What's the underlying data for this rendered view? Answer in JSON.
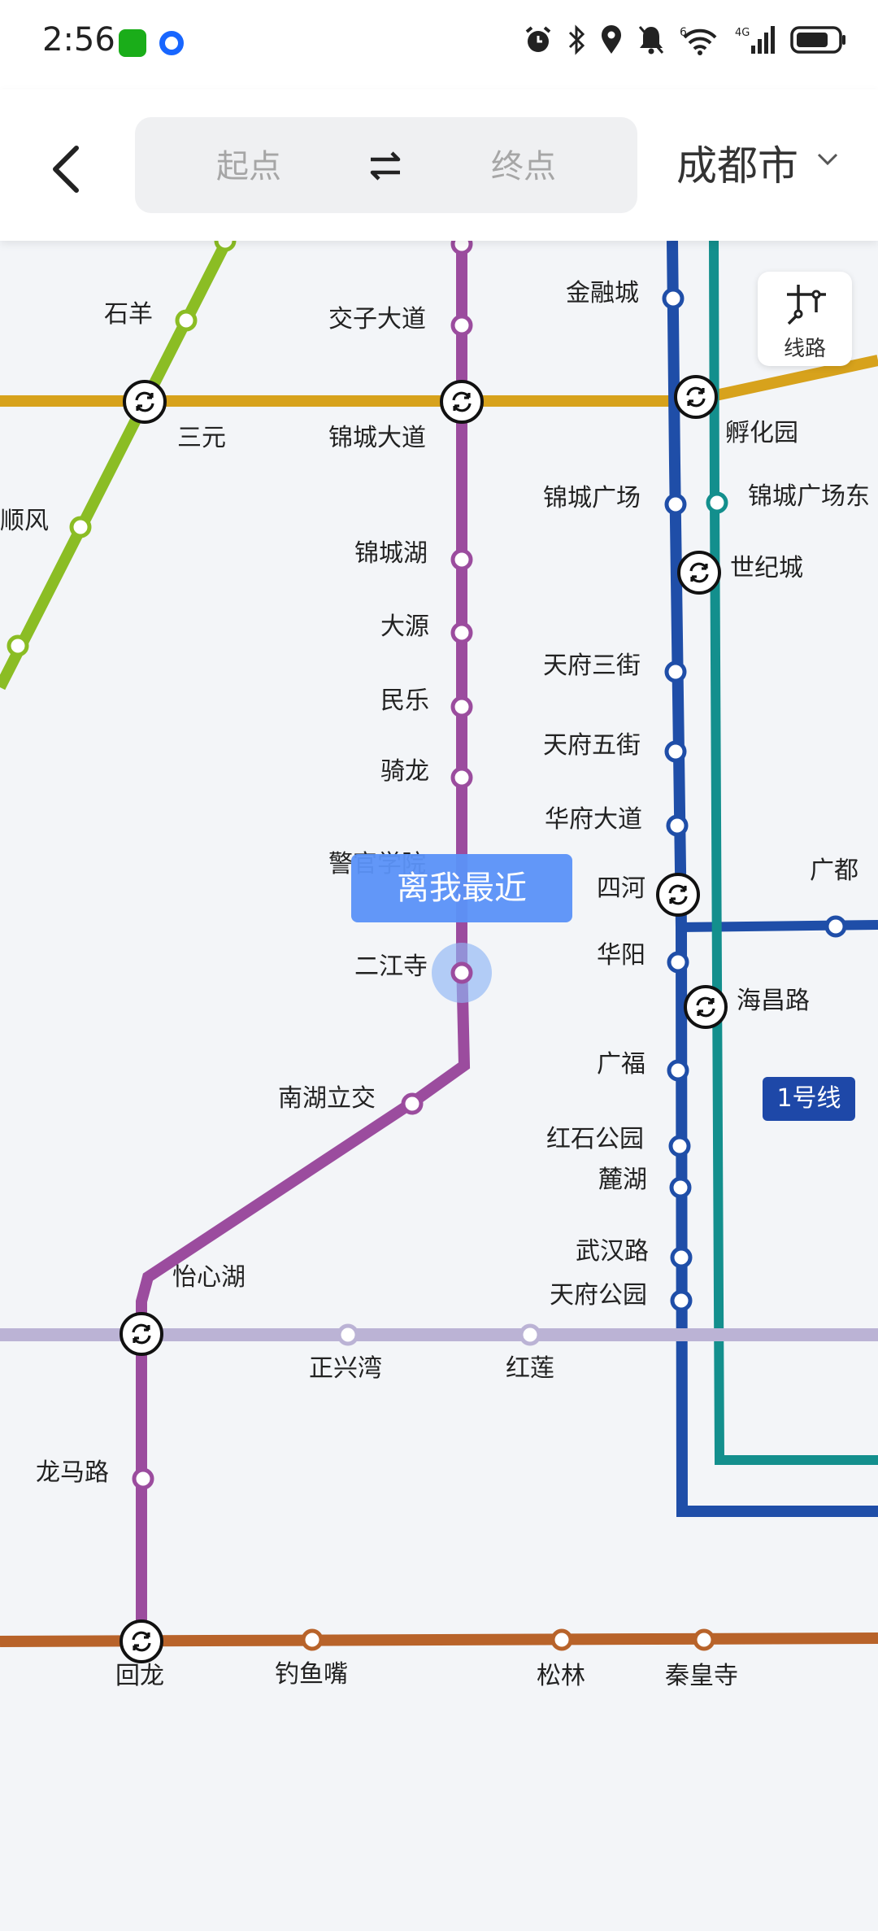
{
  "status_bar": {
    "time": "2:56",
    "icons": [
      "wechat-icon",
      "app-dot-icon",
      "alarm-icon",
      "bluetooth-icon",
      "location-icon",
      "mute-icon",
      "wifi-icon",
      "signal-4g-icon",
      "battery-icon"
    ],
    "wifi_badge": "6",
    "network": "4G"
  },
  "header": {
    "start_placeholder": "起点",
    "end_placeholder": "终点",
    "city": "成都市"
  },
  "map": {
    "route_button_label": "线路",
    "nearest_tag": "离我最近",
    "line_badge": "1号线",
    "line_colors": {
      "green": "#8bbd24",
      "purple": "#9b4c9e",
      "yellow": "#d7a21c",
      "blue": "#1f4ea8",
      "teal": "#138f8d",
      "lavender": "#bbb3d5",
      "orange": "#b8632a"
    },
    "stations": {
      "top_left_partial": "",
      "top_mid_partial": "",
      "shiyang": "石羊",
      "sanyuan": "三元",
      "shunfeng": "顺风",
      "jiaozi_dadao": "交子大道",
      "jincheng_dadao": "锦城大道",
      "jincheng_hu": "锦城湖",
      "dayuan": "大源",
      "minle": "民乐",
      "qilong": "骑龙",
      "jingguan_xueyuan": "警官学院",
      "erjiangsi": "二江寺",
      "nanhu_lijiao": "南湖立交",
      "yixinhu": "怡心湖",
      "zhengxingwan": "正兴湾",
      "honglian": "红莲",
      "longmalu": "龙马路",
      "huilong": "回龙",
      "diaoyuzui": "钓鱼嘴",
      "songlin": "松林",
      "qinhuangsi": "秦皇寺",
      "jinrongcheng": "金融城",
      "fuhuayuan": "孵化园",
      "jincheng_guangchang": "锦城广场",
      "jincheng_guangchang_dong": "锦城广场东",
      "shijicheng": "世纪城",
      "tianfu_sanjie": "天府三街",
      "tianfu_wujie": "天府五街",
      "huafu_dadao": "华府大道",
      "sihe": "四河",
      "guangdu": "广都",
      "huayang": "华阳",
      "haichanglu": "海昌路",
      "guangfu": "广福",
      "hongshi_gongyuan": "红石公园",
      "luhu": "麓湖",
      "wuhanlu": "武汉路",
      "tianfu_gongyuan": "天府公园",
      "edge_partial": ""
    }
  }
}
